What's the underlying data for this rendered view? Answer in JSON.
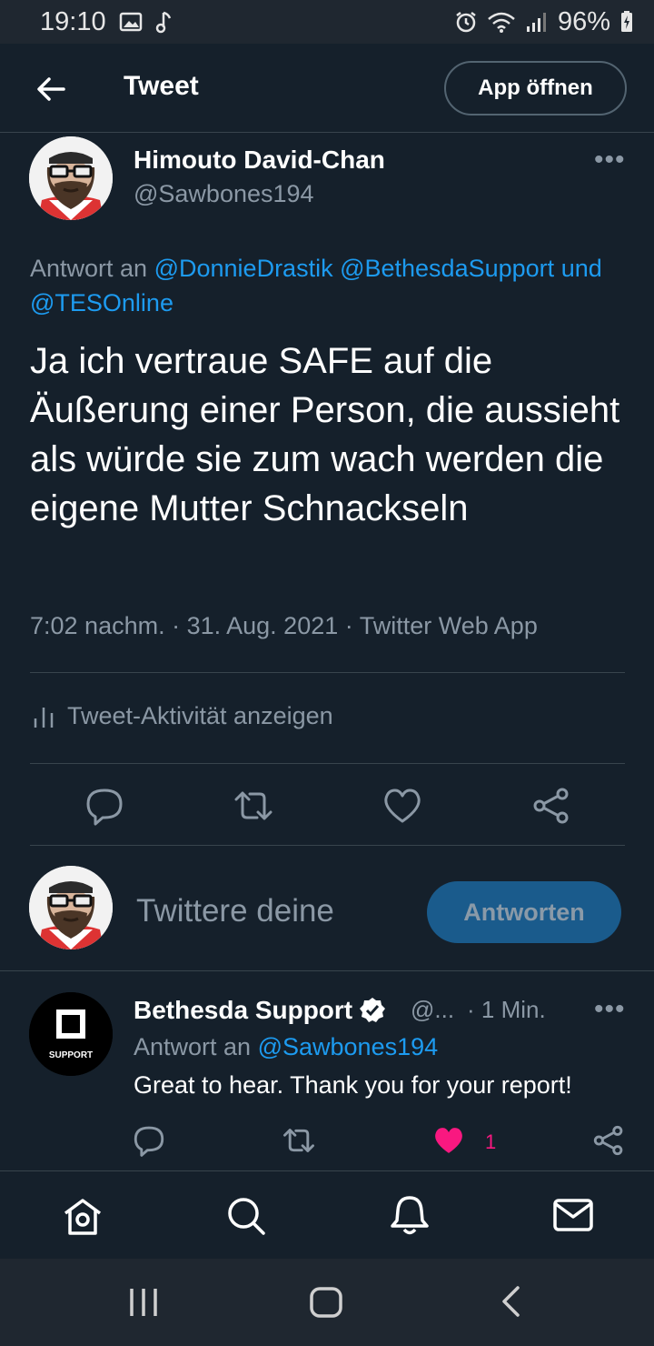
{
  "statusbar": {
    "time": "19:10",
    "battery": "96%"
  },
  "header": {
    "title": "Tweet",
    "open_app": "App öffnen"
  },
  "tweet": {
    "author_name": "Himouto David-Chan",
    "author_handle": "@Sawbones194",
    "reply_prefix": "Antwort an",
    "mention1": "@DonnieDrastik",
    "mention2": "@BethesdaSupport",
    "reply_and": "und",
    "mention3": "@TESOnline",
    "text": "Ja ich vertraue SAFE auf die Äußerung einer Person, die aussieht als würde sie zum wach werden die eigene Mutter Schnackseln",
    "meta": "7:02 nachm. · 31. Aug. 2021 · Twitter Web App",
    "activity": "Tweet-Aktivität anzeigen"
  },
  "compose": {
    "placeholder": "Twittere deine",
    "button": "Antworten"
  },
  "reply": {
    "name": "Bethesda Support",
    "handle": "@...",
    "time": "· 1 Min.",
    "reply_prefix": "Antwort an",
    "mention": "@Sawbones194",
    "text": "Great to hear. Thank you for your report!",
    "like_count": "1",
    "avatar_text": "SUPPORT"
  },
  "colors": {
    "background": "#15202b",
    "accent": "#1d9bf0",
    "like": "#f91880",
    "muted": "#8b98a5"
  }
}
